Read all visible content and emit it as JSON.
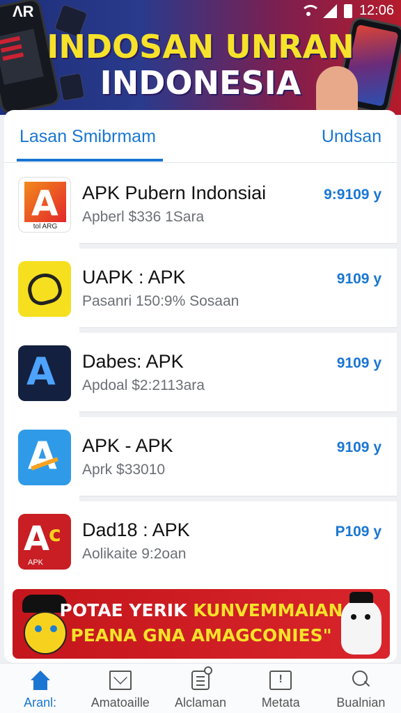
{
  "status_bar": {
    "time": "12:06",
    "logo": "ɅR"
  },
  "banner": {
    "line1": "INDOSAN UNRAN",
    "line2": "INDONESIA"
  },
  "tabs": {
    "left": "Lasan Smibrmam",
    "right": "Undsan"
  },
  "apps": [
    {
      "name": "APK Pubern Indonsiai",
      "subtitle": "Apberl $336 1Sara",
      "value": "9:9109 y",
      "icon": "apk-red-orange-icon",
      "icon_text": "ꓮ",
      "icon_caption": "tol ARG"
    },
    {
      "name": "UAPK : APK",
      "subtitle": "Pasanri 150:9% Sosaan",
      "value": "9109 y",
      "icon": "yellow-heart-icon"
    },
    {
      "name": "Dabes: APK",
      "subtitle": "Apdoal $2:2113ara",
      "value": "9109 y",
      "icon": "dark-apk-icon",
      "icon_text": "A"
    },
    {
      "name": "APK - APK",
      "subtitle": "Aprk $33010",
      "value": "9109 y",
      "icon": "blue-apk-icon",
      "icon_text": "A"
    },
    {
      "name": "Dad18 : APK",
      "subtitle": "Aolikaite 9:2oan",
      "value": "P109 y",
      "icon": "red-apk-icon",
      "icon_text": "A",
      "icon_extra": "c",
      "icon_caption": "APK"
    }
  ],
  "promo": {
    "line1_a": "POTAE YERIK ",
    "line1_b": "KUNVEMMAIAN",
    "line2": "PEANA GNA AMAGCONIES\""
  },
  "nav": [
    {
      "label": "Aranl:",
      "icon": "home-icon",
      "active": true
    },
    {
      "label": "Amatoaille",
      "icon": "mail-icon",
      "active": false
    },
    {
      "label": "Alclaman",
      "icon": "document-icon",
      "active": false
    },
    {
      "label": "Metata",
      "icon": "inbox-icon",
      "active": false
    },
    {
      "label": "Bualnian",
      "icon": "search-icon",
      "active": false
    }
  ],
  "colors": {
    "accent": "#1976d2",
    "banner_red": "#c4161c",
    "banner_yellow": "#f6e22a"
  }
}
